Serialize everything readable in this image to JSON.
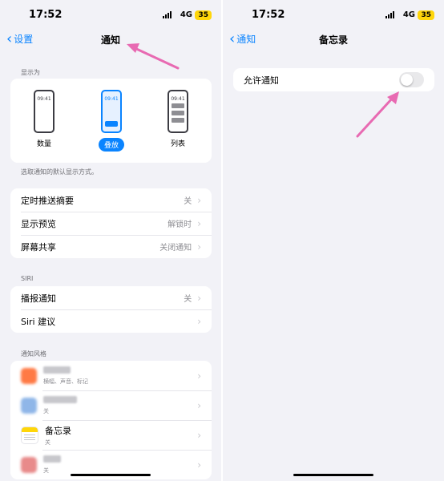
{
  "colors": {
    "accent": "#0a84ff",
    "arrow": "#e86ab2",
    "battery": "#ffd60a"
  },
  "left": {
    "status": {
      "time": "17:52",
      "network": "4G",
      "battery": "35"
    },
    "nav": {
      "back_label": "设置",
      "title": "通知"
    },
    "display_as": {
      "section_label": "显示为",
      "phone_time": "09:41",
      "options": [
        {
          "label": "数量",
          "selected": false
        },
        {
          "label": "叠放",
          "selected": true
        },
        {
          "label": "列表",
          "selected": false
        }
      ],
      "hint": "选取通知的默认显示方式。"
    },
    "settings_group": [
      {
        "label": "定时推送摘要",
        "value": "关"
      },
      {
        "label": "显示预览",
        "value": "解锁时"
      },
      {
        "label": "屏幕共享",
        "value": "关闭通知"
      }
    ],
    "siri": {
      "section_label": "SIRI",
      "rows": [
        {
          "label": "播报通知",
          "value": "关"
        },
        {
          "label": "Siri 建议",
          "value": ""
        }
      ]
    },
    "notification_style": {
      "section_label": "通知风格",
      "apps": [
        {
          "name": "",
          "subtitle": "横幅、声音、标记",
          "icon": "blurred-app-icon-orange"
        },
        {
          "name": "",
          "subtitle": "关",
          "icon": "blurred-app-icon-blue"
        },
        {
          "name": "备忘录",
          "subtitle": "关",
          "icon": "notes-app-icon"
        },
        {
          "name": "",
          "subtitle": "关",
          "icon": "blurred-app-icon-red"
        }
      ]
    }
  },
  "right": {
    "status": {
      "time": "17:52",
      "network": "4G",
      "battery": "35"
    },
    "nav": {
      "back_label": "通知",
      "title": "备忘录"
    },
    "allow_notifications": {
      "label": "允许通知",
      "enabled": false
    }
  }
}
